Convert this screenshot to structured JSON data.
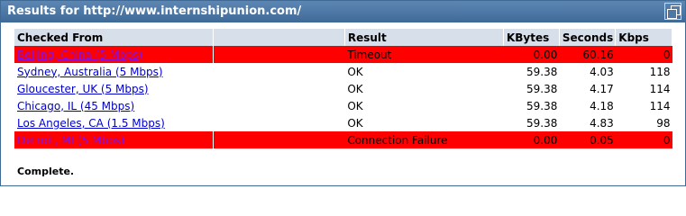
{
  "header": {
    "title": "Results for http://www.internshipunion.com/"
  },
  "table": {
    "columns": [
      "Checked From",
      "Result",
      "KBytes",
      "Seconds",
      "Kbps"
    ],
    "rows": [
      {
        "location": "Beijing, China (5 Mbps)",
        "result": "Timeout",
        "kbytes": "0.00",
        "seconds": "60.16",
        "kbps": "0",
        "status": "fail"
      },
      {
        "location": "Sydney, Australia (5 Mbps)",
        "result": "OK",
        "kbytes": "59.38",
        "seconds": "4.03",
        "kbps": "118",
        "status": "ok"
      },
      {
        "location": "Gloucester, UK (5 Mbps)",
        "result": "OK",
        "kbytes": "59.38",
        "seconds": "4.17",
        "kbps": "114",
        "status": "ok"
      },
      {
        "location": "Chicago, IL (45 Mbps)",
        "result": "OK",
        "kbytes": "59.38",
        "seconds": "4.18",
        "kbps": "114",
        "status": "ok"
      },
      {
        "location": "Los Angeles, CA (1.5 Mbps)",
        "result": "OK",
        "kbytes": "59.38",
        "seconds": "4.83",
        "kbps": "98",
        "status": "ok"
      },
      {
        "location": "Detroit, MI (5 Mbps)",
        "result": "Connection Failure",
        "kbytes": "0.00",
        "seconds": "0.05",
        "kbps": "0",
        "status": "fail"
      }
    ]
  },
  "footer": {
    "status": "Complete."
  },
  "colors": {
    "header_bg": "#4d77a5",
    "column_header_bg": "#d7dfea",
    "fail_row_bg": "#ff0000",
    "link": "#0000cc",
    "fail_link": "#8a0fd8"
  }
}
